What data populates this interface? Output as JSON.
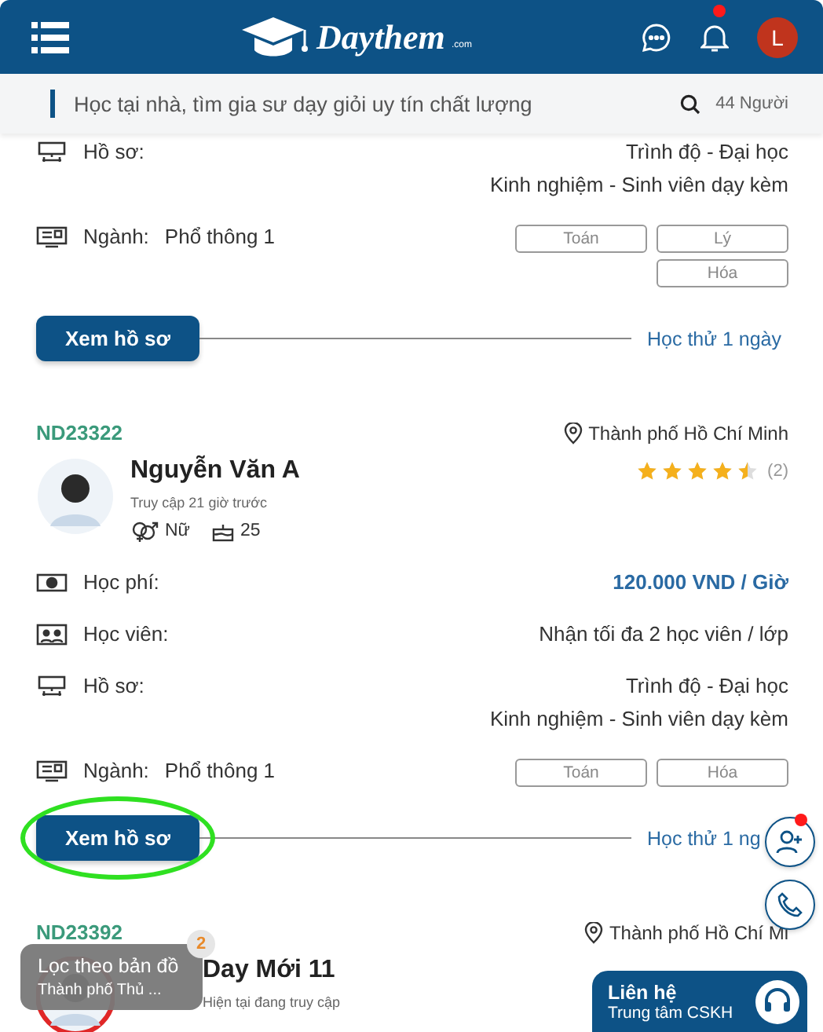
{
  "header": {
    "logo": "Daythem",
    "logo_sub": ".com",
    "avatar_initial": "L",
    "notification_unread": true
  },
  "search": {
    "placeholder": "Học tại nhà, tìm gia sư dạy giỏi uy tín chất lượng",
    "count": "44 Người"
  },
  "tutors": [
    {
      "rows": [
        {
          "kind": "profile",
          "label": "Hồ sơ:",
          "values": [
            "Trình độ - Đại học",
            "Kinh nghiệm - Sinh viên dạy kèm"
          ]
        }
      ],
      "major": {
        "label": "Ngành:",
        "value": "Phổ thông 1",
        "subjects": [
          "Toán",
          "Lý",
          "Hóa"
        ]
      },
      "button": {
        "label": "Xem hồ sơ",
        "highlighted": false
      },
      "trial": "Học thử 1 ngày"
    },
    {
      "id": "ND23322",
      "location": "Thành phố Hồ Chí Minh",
      "name": "Nguyễn Văn A",
      "access": "Truy cập 21 giờ trước",
      "gender": "Nữ",
      "age": "25",
      "stars": 4.5,
      "reviews": "(2)",
      "rows": [
        {
          "kind": "fee",
          "label": "Học phí:",
          "values": [
            "120.000 VND / Giờ"
          ]
        },
        {
          "kind": "students",
          "label": "Học viên:",
          "values": [
            "Nhận tối đa 2 học viên / lớp"
          ]
        },
        {
          "kind": "profile",
          "label": "Hồ sơ:",
          "values": [
            "Trình độ - Đại học",
            "Kinh nghiệm - Sinh viên dạy kèm"
          ]
        }
      ],
      "major": {
        "label": "Ngành:",
        "value": "Phổ thông 1",
        "subjects": [
          "Toán",
          "Hóa"
        ]
      },
      "button": {
        "label": "Xem hồ sơ",
        "highlighted": true
      },
      "trial": "Học thử 1 ng"
    },
    {
      "id": "ND23392",
      "location": "Thành phố Hồ Chí Mi",
      "name": "Day Mới 11",
      "access": "Hiện tại đang truy cập"
    }
  ],
  "filter": {
    "title": "Lọc theo bản đồ",
    "subtitle": "Thành phố Thủ ...",
    "badge": "2"
  },
  "contact": {
    "title": "Liên hệ",
    "subtitle": "Trung tâm CSKH"
  },
  "add_friend": {
    "unread": true
  }
}
